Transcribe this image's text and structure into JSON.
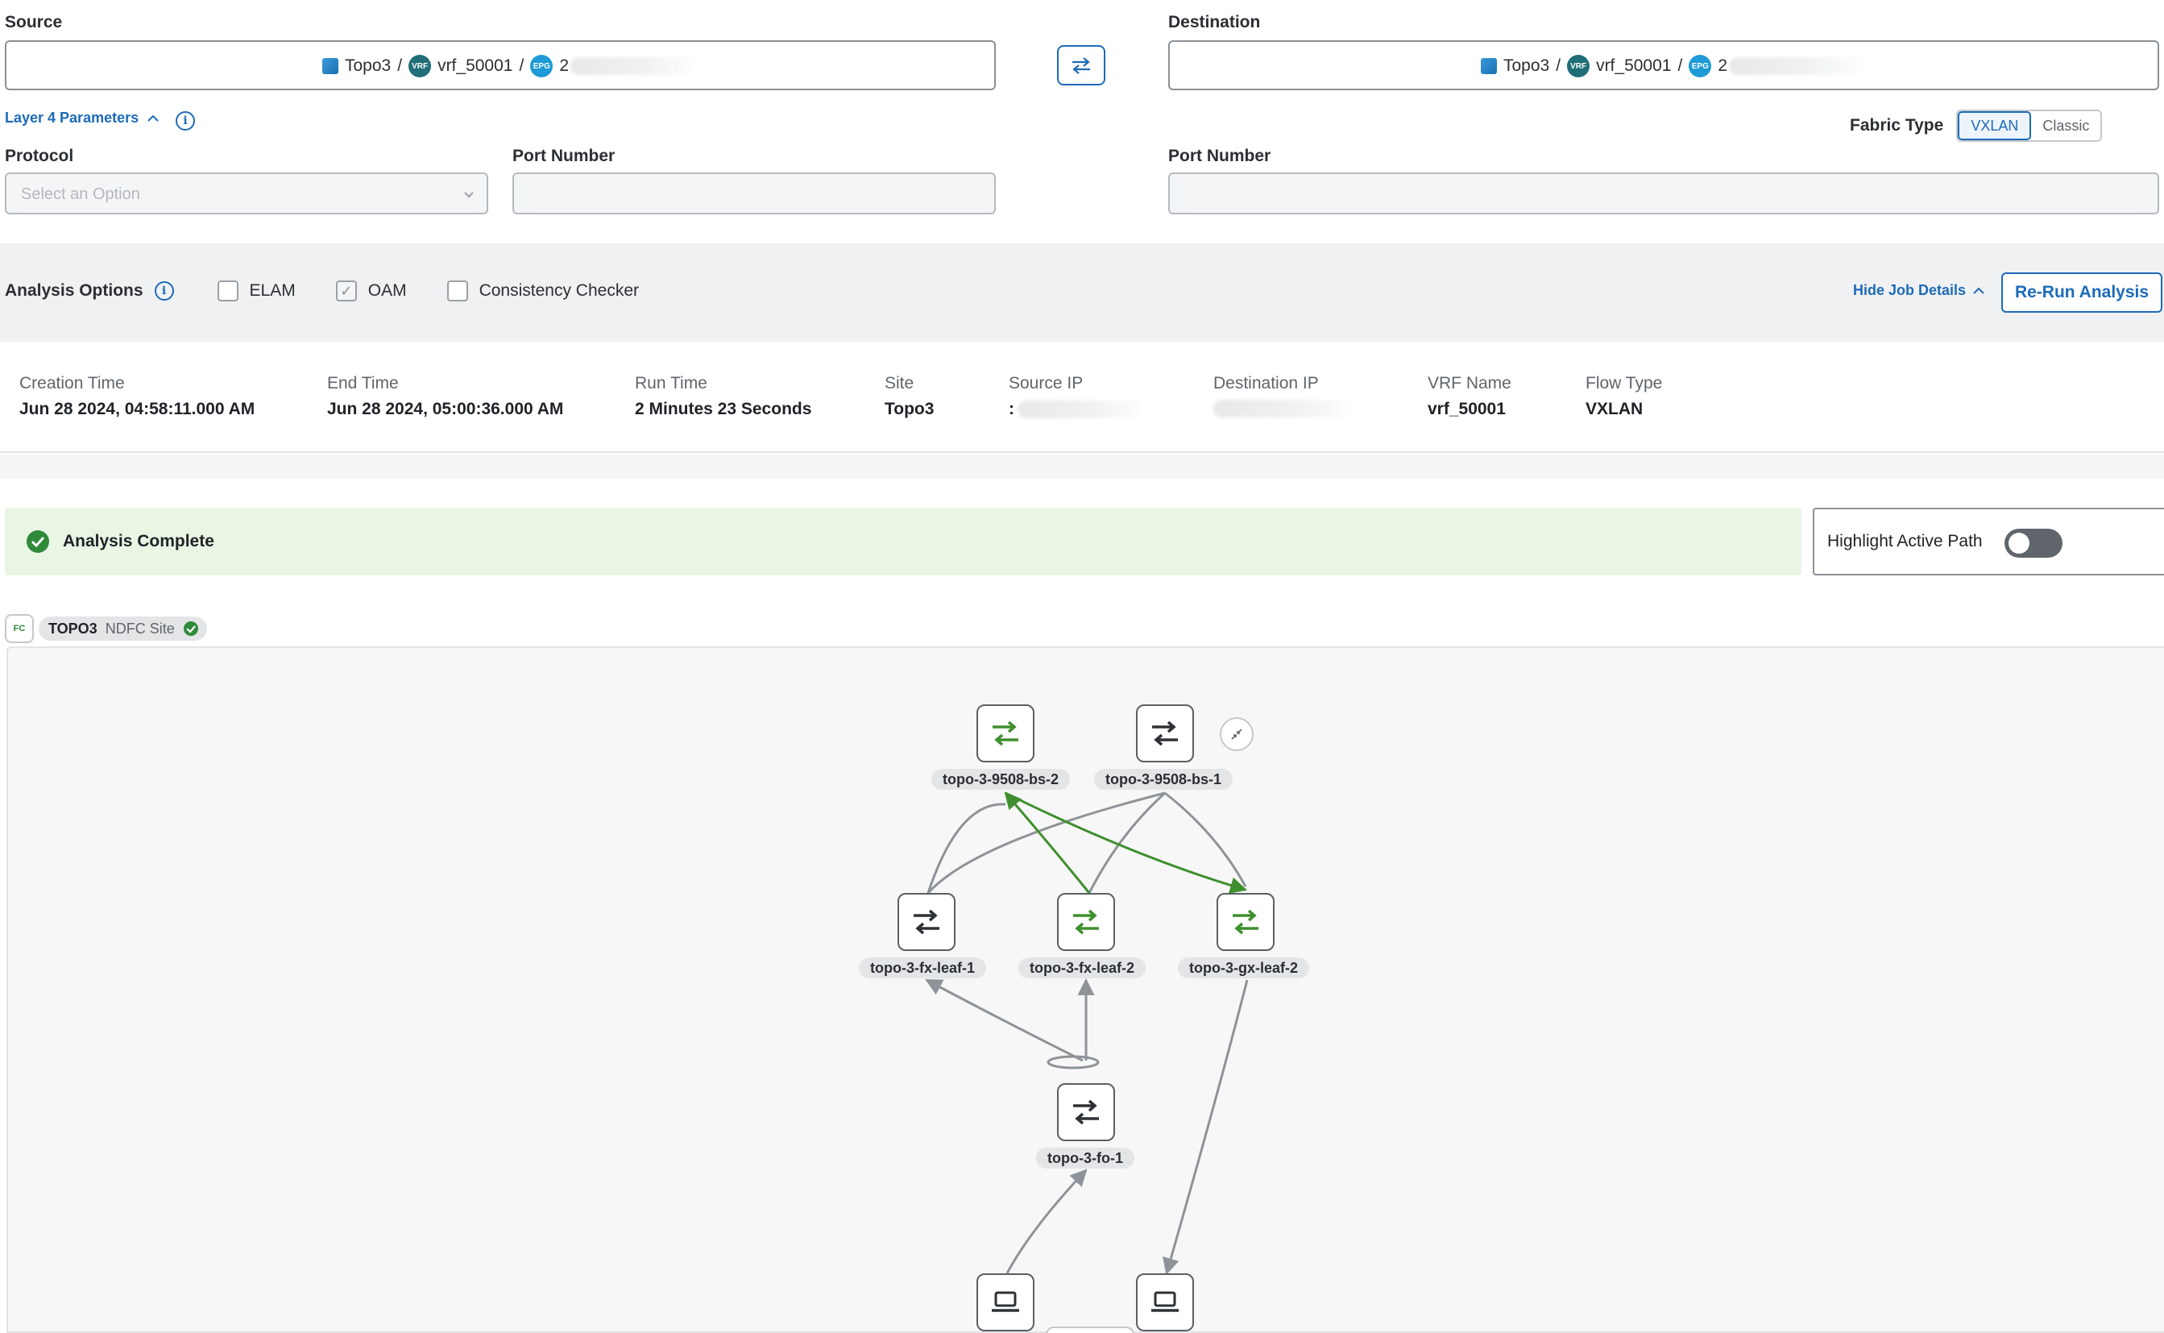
{
  "source": {
    "label": "Source",
    "site": "Topo3",
    "sep1": "/",
    "vrf_chip": "VRF",
    "vrf": "vrf_50001",
    "sep2": "/",
    "epg_chip": "EPG",
    "epg_prefix": "2"
  },
  "destination": {
    "label": "Destination",
    "site": "Topo3",
    "sep1": "/",
    "vrf_chip": "VRF",
    "vrf": "vrf_50001",
    "sep2": "/",
    "epg_chip": "EPG",
    "epg_prefix": "2"
  },
  "layer4": {
    "toggle_label": "Layer 4 Parameters",
    "protocol_label": "Protocol",
    "protocol_placeholder": "Select an Option",
    "src_port_label": "Port Number",
    "dst_port_label": "Port Number"
  },
  "fabric": {
    "label": "Fabric Type",
    "options": [
      "VXLAN",
      "Classic"
    ],
    "selected": "VXLAN"
  },
  "analysis_options": {
    "label": "Analysis Options",
    "elam": {
      "label": "ELAM",
      "checked": false
    },
    "oam": {
      "label": "OAM",
      "checked": true
    },
    "consistency": {
      "label": "Consistency Checker",
      "checked": false
    },
    "hide_details": "Hide Job Details",
    "rerun": "Re-Run Analysis"
  },
  "job": {
    "creation_time_label": "Creation Time",
    "creation_time": "Jun 28 2024, 04:58:11.000 AM",
    "end_time_label": "End Time",
    "end_time": "Jun 28 2024, 05:00:36.000 AM",
    "run_time_label": "Run Time",
    "run_time": "2 Minutes 23 Seconds",
    "site_label": "Site",
    "site": "Topo3",
    "source_ip_label": "Source IP",
    "source_ip_prefix": ":",
    "dest_ip_label": "Destination IP",
    "vrf_label": "VRF Name",
    "vrf": "vrf_50001",
    "flow_label": "Flow Type",
    "flow": "VXLAN"
  },
  "status": {
    "text": "Analysis Complete",
    "highlight_label": "Highlight Active Path",
    "highlight_on": false
  },
  "site_tag": {
    "badge": "FC",
    "name": "TOPO3",
    "type": "NDFC Site"
  },
  "topology": {
    "nodes": [
      {
        "id": "bs2",
        "label": "topo-3-9508-bs-2",
        "active": true
      },
      {
        "id": "bs1",
        "label": "topo-3-9508-bs-1",
        "active": false
      },
      {
        "id": "fx1",
        "label": "topo-3-fx-leaf-1",
        "active": false
      },
      {
        "id": "fx2",
        "label": "topo-3-fx-leaf-2",
        "active": true
      },
      {
        "id": "gx2",
        "label": "topo-3-gx-leaf-2",
        "active": true
      },
      {
        "id": "fo1",
        "label": "topo-3-fo-1",
        "active": false
      },
      {
        "id": "host1",
        "label": "",
        "active": false
      },
      {
        "id": "host2",
        "label": "",
        "active": false
      }
    ],
    "colors": {
      "active": "#3f8f2e",
      "inactive": "#8e9399",
      "status_bg": "#e9f6e4",
      "status_icon": "#2f8a3a",
      "accent": "#1d6bb8"
    }
  }
}
